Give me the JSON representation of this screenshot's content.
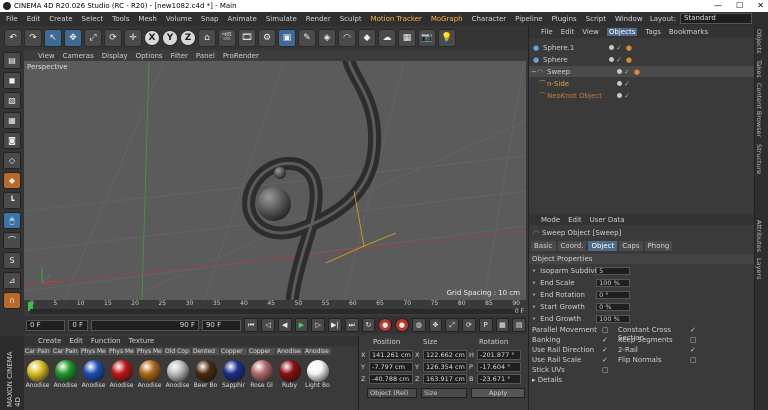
{
  "window": {
    "title": "CINEMA 4D R20.026 Studio (RC - R20) - [new1082.c4d *] - Main"
  },
  "menu": [
    "File",
    "Edit",
    "Create",
    "Select",
    "Tools",
    "Mesh",
    "Volume",
    "Snap",
    "Animate",
    "Simulate",
    "Render",
    "Sculpt",
    "Motion Tracker",
    "MoGraph",
    "Character",
    "Pipeline",
    "Plugins",
    "Script",
    "Window"
  ],
  "layout": {
    "label": "Layout:",
    "value": "Standard"
  },
  "toolbar": {
    "axes": [
      "X",
      "Y",
      "Z"
    ]
  },
  "viewport": {
    "menu": [
      "View",
      "Cameras",
      "Display",
      "Options",
      "Filter",
      "Panel",
      "ProRender"
    ],
    "label": "Perspective",
    "grid_spacing": "Grid Spacing : 10 cm"
  },
  "timeline": {
    "frames": [
      "0",
      "5",
      "10",
      "15",
      "20",
      "25",
      "30",
      "35",
      "40",
      "45",
      "50",
      "55",
      "60",
      "65",
      "70",
      "75",
      "80",
      "85",
      "90"
    ],
    "end_label": "0 F"
  },
  "transport": {
    "current": "0 F",
    "start": "0 F",
    "preview_end": "90 F",
    "end": "90 F"
  },
  "materials": {
    "tabs": [
      "Create",
      "Edit",
      "Function",
      "Texture"
    ],
    "top_names": [
      "Car Pain",
      "Car Pain",
      "Phys Me",
      "Phys Me",
      "Phys Me",
      "Old Cop",
      "Dented",
      "Copper",
      "Copper",
      "Anodise",
      "Anodise"
    ],
    "items": [
      {
        "name": "Anodise",
        "color": "#d8c020"
      },
      {
        "name": "Anodise",
        "color": "#1e9a2a"
      },
      {
        "name": "Anodise",
        "color": "#1b4fb0"
      },
      {
        "name": "Anodise",
        "color": "#c01515"
      },
      {
        "name": "Anodise",
        "color": "#b0681a"
      },
      {
        "name": "Anodise",
        "color": "#bdbdbd"
      },
      {
        "name": "Beer Bo",
        "color": "#4a2a10"
      },
      {
        "name": "Sapphir",
        "color": "#1a2f8a"
      },
      {
        "name": "Rose Gl",
        "color": "#b06a6a"
      },
      {
        "name": "Ruby",
        "color": "#8a1010"
      },
      {
        "name": "Light Bo",
        "color": "#f5f5f5"
      }
    ]
  },
  "coords": {
    "headers": [
      "Position",
      "Size",
      "Rotation"
    ],
    "rows": [
      {
        "axis": "X",
        "pos": "141.261 cm",
        "size": "122.662 cm",
        "rl": "H",
        "rot": "-201.877 °"
      },
      {
        "axis": "Y",
        "pos": "-7.797 cm",
        "size": "126.354 cm",
        "rl": "P",
        "rot": "-17.604 °"
      },
      {
        "axis": "Z",
        "pos": "-40.788 cm",
        "size": "163.917 cm",
        "rl": "B",
        "rot": "-23.671 °"
      }
    ],
    "mode": "Object (Rel)",
    "size_mode": "Size",
    "apply": "Apply"
  },
  "objects": {
    "tabs": [
      "File",
      "Edit",
      "View",
      "Objects",
      "Tags",
      "Bookmarks"
    ],
    "items": [
      {
        "name": "Sphere.1",
        "color": "#cfcfcf"
      },
      {
        "name": "Sphere",
        "color": "#cfcfcf"
      },
      {
        "name": "Sweep",
        "color": "#cfcfcf"
      },
      {
        "name": "n-Side",
        "color": "#d8a050"
      },
      {
        "name": "NeoKnot Object",
        "color": "#c87a40"
      }
    ]
  },
  "attributes": {
    "menu": [
      "Mode",
      "Edit",
      "User Data"
    ],
    "object": "Sweep Object [Sweep]",
    "tabs": [
      "Basic",
      "Coord.",
      "Object",
      "Caps",
      "Phong"
    ],
    "section": "Object Properties",
    "fields": [
      {
        "label": "Isoparm Subdivision",
        "value": "5"
      },
      {
        "label": "End Scale",
        "value": "100 %"
      },
      {
        "label": "End Rotation",
        "value": "0 °"
      },
      {
        "label": "Start Growth",
        "value": "0 %"
      },
      {
        "label": "End Growth",
        "value": "100 %"
      }
    ],
    "checks_left": [
      "Parallel Movement",
      "Banking",
      "Use Rail Direction",
      "Use Rail Scale",
      "Stick UVs"
    ],
    "checks_right": [
      "Constant Cross Section",
      "Keep Segments",
      "2-Rail",
      "Flip Normals"
    ],
    "details": "Details"
  },
  "side_tabs": [
    "Objects",
    "Takes",
    "Content Browser",
    "Structure",
    "Attributes",
    "Layers"
  ],
  "brand": "MAXON CINEMA 4D"
}
